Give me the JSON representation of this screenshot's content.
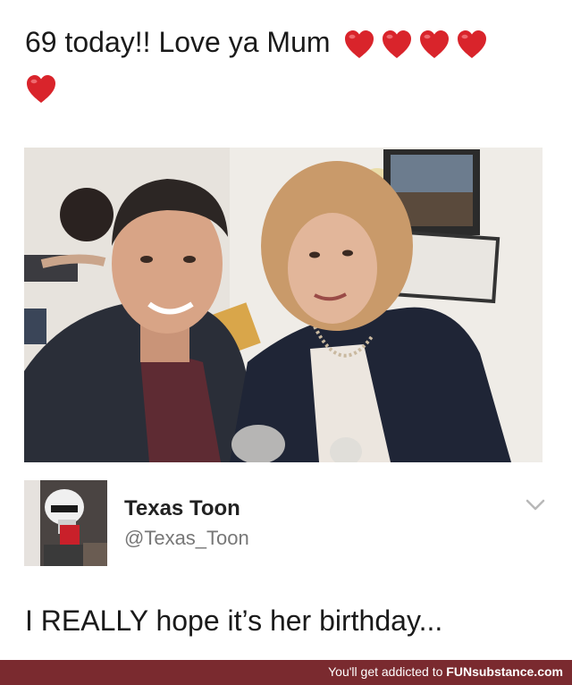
{
  "post": {
    "text": "69 today!! Love ya Mum",
    "heart_icon": "red-heart-emoji",
    "heart_count": 5,
    "heart_color": "#d9242b"
  },
  "photo": {
    "icon": "selfie-photo"
  },
  "tweet": {
    "display_name": "Texas Toon",
    "handle": "@Texas_Toon",
    "menu_icon": "chevron-down-icon",
    "reply": "I REALLY hope it’s her birthday..."
  },
  "footer": {
    "prefix": "You'll get addicted to ",
    "brand_caps": "FUN",
    "brand_rest": "substance.com",
    "color": "#7a2a2f"
  }
}
